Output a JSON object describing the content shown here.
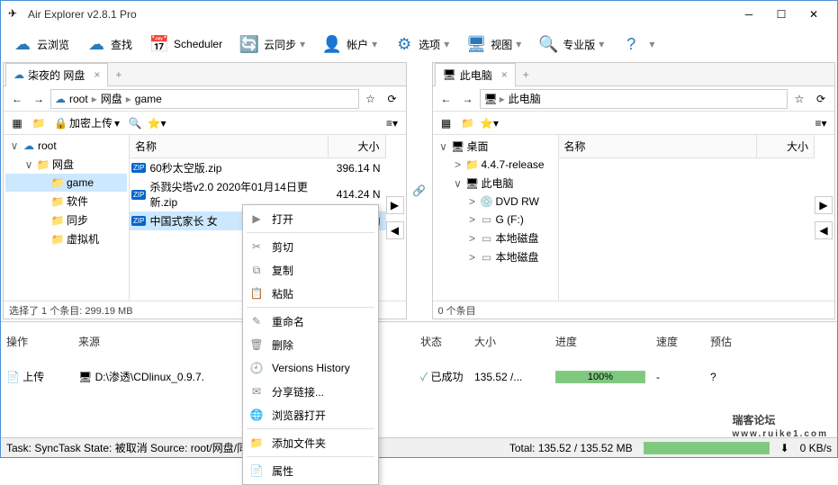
{
  "window": {
    "title": "Air Explorer v2.8.1 Pro"
  },
  "toolbar": [
    {
      "label": "云浏览",
      "icon": "cloud-browse"
    },
    {
      "label": "查找",
      "icon": "cloud-search"
    },
    {
      "label": "Scheduler",
      "icon": "calendar"
    },
    {
      "label": "云同步",
      "icon": "cloud-sync"
    },
    {
      "label": "帐户",
      "icon": "user"
    },
    {
      "label": "选项",
      "icon": "gear"
    },
    {
      "label": "视图",
      "icon": "monitor"
    },
    {
      "label": "专业版",
      "icon": "badge"
    },
    {
      "label": "",
      "icon": "help"
    }
  ],
  "left": {
    "tab": "柒夜的 网盘",
    "breadcrumb": [
      "root",
      "网盘",
      "game"
    ],
    "toolbar2_encrypt": "加密上传",
    "tree": [
      {
        "depth": 0,
        "exp": "∨",
        "icon": "cloud",
        "label": "root"
      },
      {
        "depth": 1,
        "exp": "∨",
        "icon": "folder",
        "label": "网盘"
      },
      {
        "depth": 2,
        "exp": "",
        "icon": "folder",
        "label": "game",
        "sel": true
      },
      {
        "depth": 2,
        "exp": "",
        "icon": "folder",
        "label": "软件"
      },
      {
        "depth": 2,
        "exp": "",
        "icon": "folder",
        "label": "同步"
      },
      {
        "depth": 2,
        "exp": "",
        "icon": "folder",
        "label": "虚拟机"
      }
    ],
    "cols": {
      "name": "名称",
      "size": "大小"
    },
    "rows": [
      {
        "icon": "zip",
        "name": "60秒太空版.zip",
        "size": "396.14 N"
      },
      {
        "icon": "zip",
        "name": "杀戮尖塔v2.0 2020年01月14日更新.zip",
        "size": "414.24 N"
      },
      {
        "icon": "zip",
        "name": "中国式家长 女",
        "size": "9 N",
        "sel": true
      }
    ],
    "status": "选择了 1 个条目: 299.19 MB"
  },
  "right": {
    "tab": "此电脑",
    "breadcrumb": [
      "此电脑"
    ],
    "tree": [
      {
        "depth": 0,
        "exp": "∨",
        "icon": "monitor",
        "label": "桌面"
      },
      {
        "depth": 1,
        "exp": ">",
        "icon": "folder",
        "label": "4.4.7-release"
      },
      {
        "depth": 1,
        "exp": "∨",
        "icon": "monitor",
        "label": "此电脑"
      },
      {
        "depth": 2,
        "exp": ">",
        "icon": "disc",
        "label": "DVD RW"
      },
      {
        "depth": 2,
        "exp": ">",
        "icon": "disk",
        "label": "G (F:)"
      },
      {
        "depth": 2,
        "exp": ">",
        "icon": "disk",
        "label": "本地磁盘"
      },
      {
        "depth": 2,
        "exp": ">",
        "icon": "disk",
        "label": "本地磁盘"
      }
    ],
    "cols": {
      "name": "名称",
      "size": "大小"
    },
    "status": "0 个条目"
  },
  "context_menu": [
    {
      "icon": "open",
      "label": "打开"
    },
    {
      "sep": true
    },
    {
      "icon": "cut",
      "label": "剪切"
    },
    {
      "icon": "copy",
      "label": "复制"
    },
    {
      "icon": "paste",
      "label": "粘贴"
    },
    {
      "sep": true
    },
    {
      "icon": "rename",
      "label": "重命名"
    },
    {
      "icon": "delete",
      "label": "删除"
    },
    {
      "icon": "history",
      "label": "Versions History"
    },
    {
      "icon": "share",
      "label": "分享链接..."
    },
    {
      "icon": "browser",
      "label": "浏览器打开"
    },
    {
      "sep": true
    },
    {
      "icon": "addfolder",
      "label": "添加文件夹"
    },
    {
      "sep": true
    },
    {
      "icon": "props",
      "label": "属性"
    }
  ],
  "tasks": {
    "hdr": {
      "op": "操作",
      "src": "来源",
      "status": "状态",
      "size": "大小",
      "progress": "进度",
      "speed": "速度",
      "eta": "预估"
    },
    "rows": [
      {
        "op": "上传",
        "src": "D:\\渗透\\CDlinux_0.9.7.",
        "status": "已成功",
        "size": "135.52 /...",
        "progress": "100%",
        "speed": "-",
        "eta": "?"
      }
    ]
  },
  "bottom": {
    "task": "Task: SyncTask State: 被取消 Source: root/网盘/同步  Destination: D:/同步",
    "total": "Total: 135.52 / 135.52 MB",
    "speed": "0 KB/s"
  },
  "watermark": {
    "big": "瑞客论坛",
    "small": "www.ruike1.com"
  }
}
